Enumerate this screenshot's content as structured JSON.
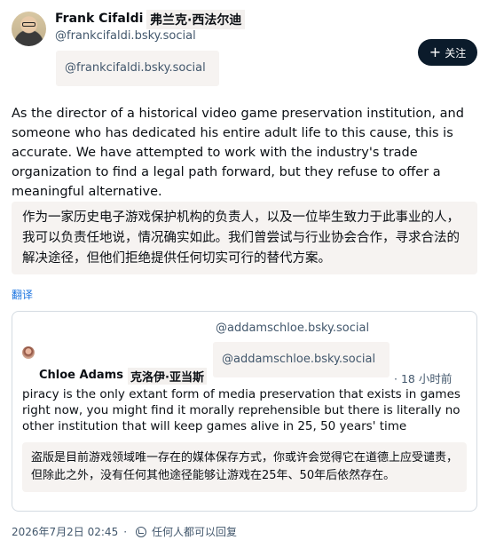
{
  "author": {
    "name": "Frank Cifaldi",
    "name_translated": "弗兰克·西法尔迪",
    "handle": "@frankcifaldi.bsky.social",
    "handle_chip": "@frankcifaldi.bsky.social"
  },
  "follow_button": {
    "icon": "plus-icon",
    "label": "关注"
  },
  "post": {
    "text": "As the director of a historical video game preservation institution, and someone who has dedicated his entire adult life to this cause, this is accurate. We have attempted to work with the industry's trade organization to find a legal path forward, but they refuse to offer a meaningful alternative.",
    "translation": "作为一家历史电子游戏保护机构的负责人，以及一位毕生致力于此事业的人，我可以负责任地说，情况确实如此。我们曾尝试与行业协会合作，寻求合法的解决途径，但他们拒绝提供任何切实可行的替代方案。",
    "translate_link": "翻译"
  },
  "quote": {
    "handle_top": "@addamschloe.bsky.social",
    "handle_chip": "@addamschloe.bsky.social",
    "author_name": "Chloe Adams",
    "author_name_translated": "克洛伊·亚当斯",
    "time": "· 18 小时前",
    "text": "piracy is the only extant form of media preservation that exists in games right now, you might find it morally reprehensible but there is literally no other institution that will keep games alive in 25, 50 years' time",
    "translation": "盗版是目前游戏领域唯一存在的媒体保存方式，你或许会觉得它在道德上应受谴责，但除此之外，没有任何其他途径能够让游戏在25年、50年后依然存在。"
  },
  "footer": {
    "date": "2026年7月2日 02:45",
    "separator": "·",
    "reply_icon": "reply-permission-icon",
    "reply_text": "任何人都可以回复"
  },
  "colors": {
    "follow_button_bg": "#0b1b2b",
    "link": "#1f76e0",
    "muted_text": "#42576c",
    "chip_bg": "#f6f3f1"
  }
}
